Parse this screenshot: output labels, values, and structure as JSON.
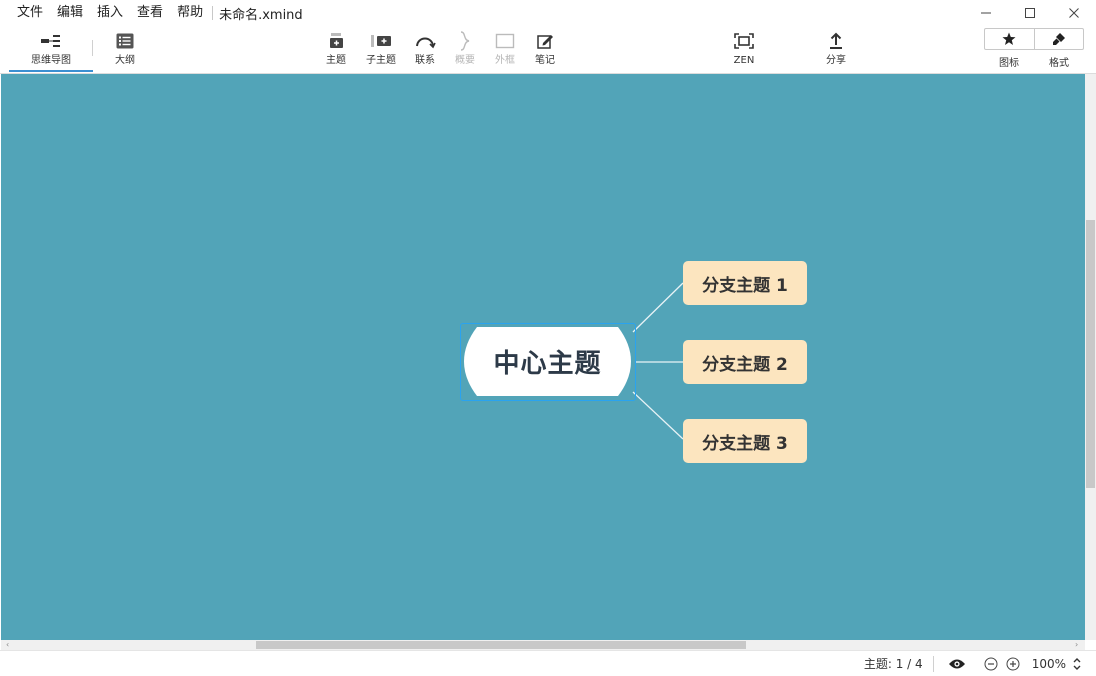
{
  "menu": {
    "items": [
      "文件",
      "编辑",
      "插入",
      "查看",
      "帮助"
    ],
    "doc_title": "未命名.xmind"
  },
  "toolbar": {
    "views": [
      {
        "label": "思维导图",
        "icon": "mindmap-view-icon",
        "active": true
      },
      {
        "label": "大纲",
        "icon": "outline-view-icon",
        "active": false
      }
    ],
    "insert_tools": [
      {
        "label": "主题",
        "icon": "topic-icon",
        "enabled": true
      },
      {
        "label": "子主题",
        "icon": "subtopic-icon",
        "enabled": true
      },
      {
        "label": "联系",
        "icon": "relationship-icon",
        "enabled": true
      },
      {
        "label": "概要",
        "icon": "summary-icon",
        "enabled": false
      },
      {
        "label": "外框",
        "icon": "boundary-icon",
        "enabled": false
      },
      {
        "label": "笔记",
        "icon": "note-icon",
        "enabled": true
      }
    ],
    "zen": {
      "label": "ZEN",
      "icon": "zen-fullscreen-icon"
    },
    "share": {
      "label": "分享",
      "icon": "share-upload-icon"
    },
    "panels": [
      {
        "label": "图标",
        "icon": "star-icon"
      },
      {
        "label": "格式",
        "icon": "brush-icon"
      }
    ]
  },
  "canvas": {
    "background": "#52a4b8",
    "central_topic": "中心主题",
    "branches": [
      "分支主题 1",
      "分支主题 2",
      "分支主题 3"
    ],
    "branch_color": "#fce5bf",
    "selection_color": "#2aa3f0"
  },
  "statusbar": {
    "topic_count": "主题: 1 / 4",
    "zoom": "100%"
  }
}
